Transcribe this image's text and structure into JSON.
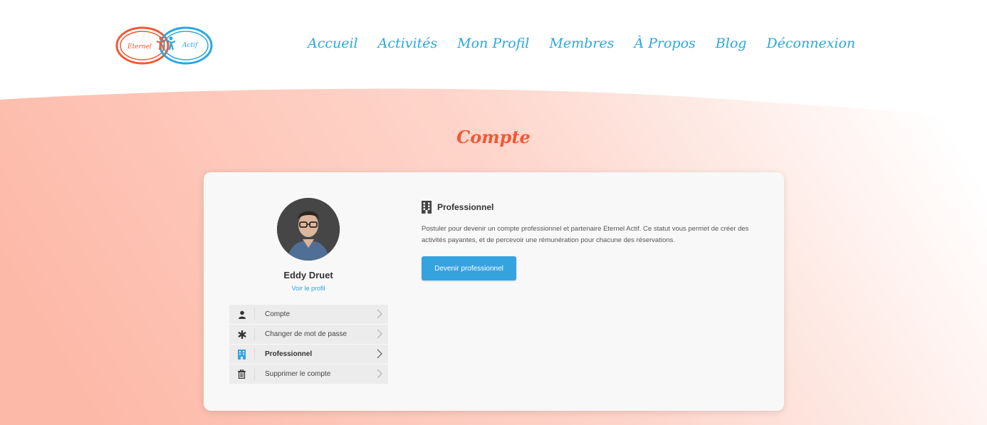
{
  "brand": {
    "logo_left": "Eternel",
    "logo_right": "Actif"
  },
  "nav": {
    "items": [
      "Accueil",
      "Activités",
      "Mon Profil",
      "Membres",
      "À Propos",
      "Blog",
      "Déconnexion"
    ]
  },
  "page": {
    "title": "Compte"
  },
  "sidebar": {
    "user_name": "Eddy Druet",
    "profile_link": "Voir le profil",
    "items": [
      {
        "label": "Compte",
        "icon": "user-icon",
        "active": false
      },
      {
        "label": "Changer de mot de passe",
        "icon": "asterisk-icon",
        "active": false
      },
      {
        "label": "Professionnel",
        "icon": "building-icon",
        "active": true
      },
      {
        "label": "Supprimer le compte",
        "icon": "trash-icon",
        "active": false
      }
    ]
  },
  "content": {
    "section_title": "Professionnel",
    "description": "Postuler pour devenir un compte professionnel et partenaire Eternel Actif. Ce statut vous permet de créer des activités payantes, et de percevoir une rémunération pour chacune des réservations.",
    "cta_label": "Devenir professionnel"
  },
  "colors": {
    "accent_blue": "#29a8df",
    "title_orange": "#ef5a35",
    "button_blue": "#35a3e0",
    "wave_salmon": "#fcc0b2"
  }
}
